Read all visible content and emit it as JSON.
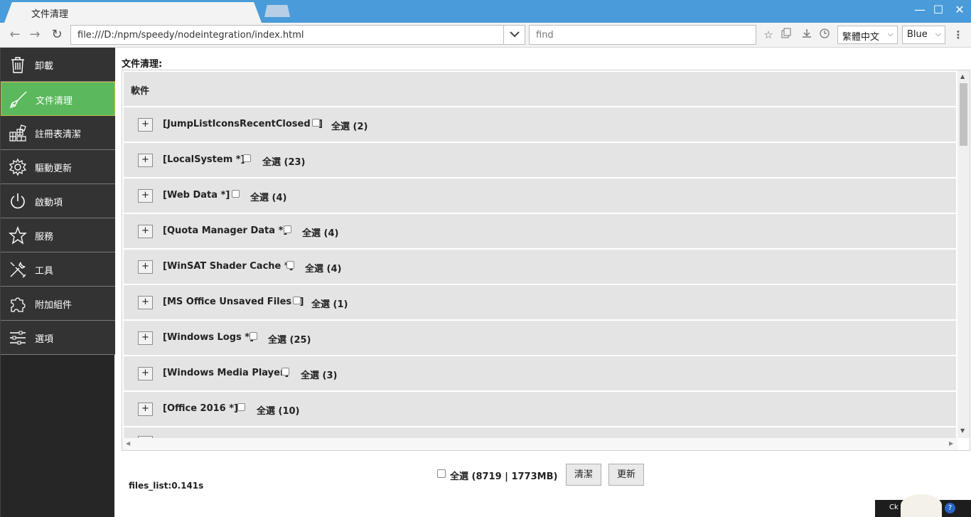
{
  "window": {
    "tab_title": "文件清理",
    "controls": {
      "minimize": "—",
      "maximize": "☐",
      "close": "✕"
    }
  },
  "toolbar": {
    "url": "file:///D:/npm/speedy/nodeintegration/index.html",
    "find_placeholder": "find",
    "language": "繁體中文",
    "theme": "Blue"
  },
  "sidebar": {
    "items": [
      {
        "label": "卸載",
        "icon": "trash-icon"
      },
      {
        "label": "文件清理",
        "icon": "broom-icon",
        "active": true
      },
      {
        "label": "註冊表清潔",
        "icon": "registry-icon"
      },
      {
        "label": "驅動更新",
        "icon": "gear-icon"
      },
      {
        "label": "啟動項",
        "icon": "power-icon"
      },
      {
        "label": "服務",
        "icon": "star-icon"
      },
      {
        "label": "工具",
        "icon": "tools-icon"
      },
      {
        "label": "附加組件",
        "icon": "puzzle-icon"
      },
      {
        "label": "選項",
        "icon": "sliders-icon"
      }
    ]
  },
  "main": {
    "title": "文件清理:",
    "header": "軟件",
    "expand_label": "+",
    "rows": [
      {
        "name": "[JumpListIconsRecentClosed *]",
        "select": "全選 (2)"
      },
      {
        "name": "[LocalSystem *]",
        "select": "全選 (23)"
      },
      {
        "name": "[Web Data *]",
        "select": "全選 (4)"
      },
      {
        "name": "[Quota Manager Data *]",
        "select": "全選 (4)"
      },
      {
        "name": "[WinSAT Shader Cache *]",
        "select": "全選 (4)"
      },
      {
        "name": "[MS Office Unsaved Files *]",
        "select": "全選 (1)"
      },
      {
        "name": "[Windows Logs *]",
        "select": "全選 (25)"
      },
      {
        "name": "[Windows Media Player]",
        "select": "全選 (3)"
      },
      {
        "name": "[Office 2016 *]",
        "select": "全選 (10)"
      }
    ]
  },
  "footer": {
    "summary": "全選 (8719 | 1773MB)",
    "clean_button": "清潔",
    "update_button": "更新",
    "files_list": "files_list:0.141s"
  },
  "tray": {
    "text": "Ck",
    "help": "?"
  },
  "colors": {
    "titlebar": "#4a9bd9",
    "active_item": "#5cb85c",
    "sidebar": "#262626"
  }
}
